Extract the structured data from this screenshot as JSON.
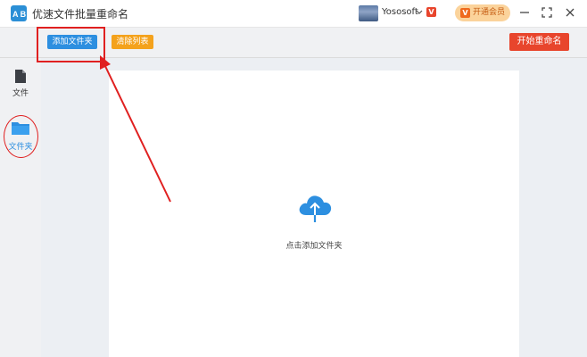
{
  "app": {
    "title": "优速文件批量重命名",
    "logo_text": "A B"
  },
  "user": {
    "name": "Yososoft",
    "vip_badge": "V"
  },
  "header": {
    "member_button": "开通会员",
    "member_icon": "V"
  },
  "window_controls": {
    "minimize": "—",
    "maximize": "⛶",
    "close": "✕"
  },
  "toolbar": {
    "add_folder": "添加文件夹",
    "clear_list": "清除列表",
    "start_rename": "开始重命名"
  },
  "sidebar": {
    "items": [
      {
        "label": "文件",
        "icon": "file-icon",
        "active": false
      },
      {
        "label": "文件夹",
        "icon": "folder-icon",
        "active": true
      }
    ]
  },
  "main": {
    "dropzone_label": "点击添加文件夹",
    "dropzone_icon": "cloud-upload-icon"
  },
  "colors": {
    "accent_blue": "#2d8fe0",
    "clear_orange": "#f4a21c",
    "start_red": "#e8452c",
    "annotation_red": "#e02020"
  }
}
